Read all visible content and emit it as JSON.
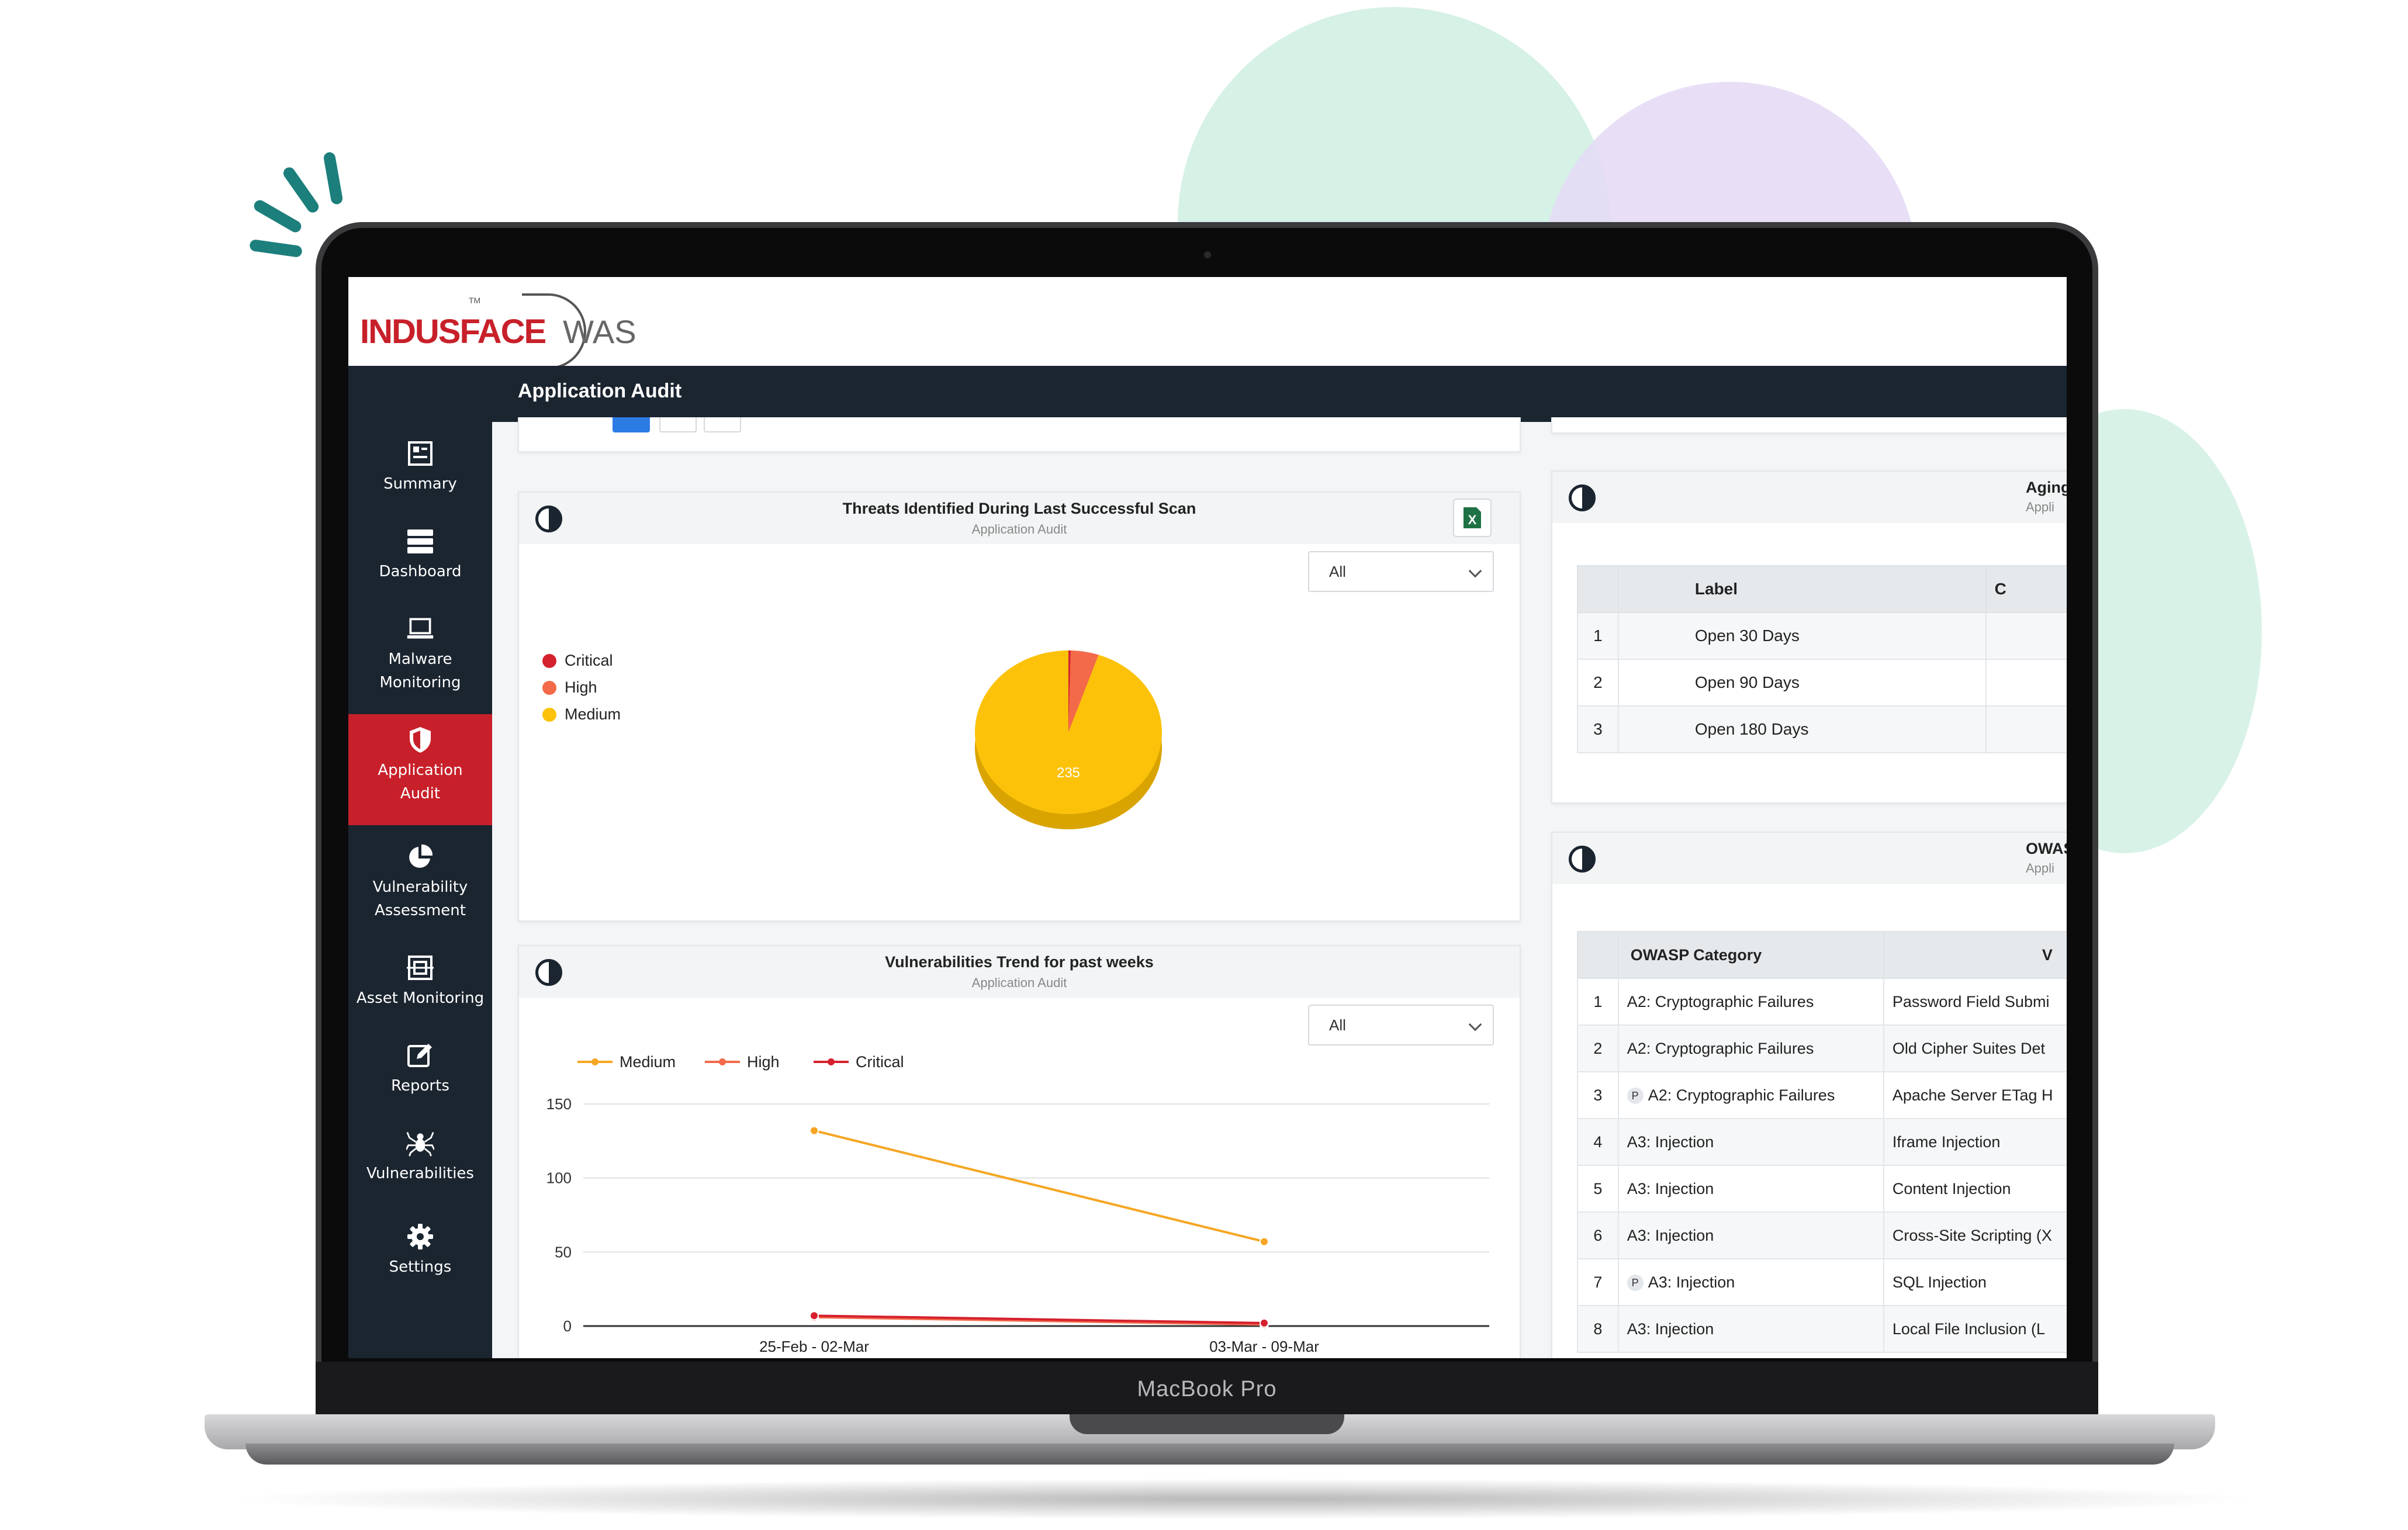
{
  "device": {
    "label": "MacBook Pro"
  },
  "app": {
    "logo_text": "INDUSFACE",
    "logo_sub": "WAS",
    "logo_tm": "TM",
    "page_title": "Application Audit"
  },
  "sidebar": {
    "items": [
      {
        "label": "Summary",
        "icon": "summary-icon"
      },
      {
        "label": "Dashboard",
        "icon": "dashboard-icon"
      },
      {
        "label": "Malware Monitoring",
        "icon": "laptop-icon"
      },
      {
        "label": "Application Audit",
        "icon": "shield-icon",
        "active": true
      },
      {
        "label": "Vulnerability Assessment",
        "icon": "pie-icon"
      },
      {
        "label": "Asset Monitoring",
        "icon": "asset-icon"
      },
      {
        "label": "Reports",
        "icon": "edit-icon"
      },
      {
        "label": "Vulnerabilities",
        "icon": "spider-icon"
      },
      {
        "label": "Settings",
        "icon": "gear-icon"
      }
    ]
  },
  "threats_card": {
    "title": "Threats Identified During Last Successful Scan",
    "subtitle": "Application Audit",
    "filter": "All",
    "legend": [
      {
        "label": "Critical",
        "color": "#d5202e"
      },
      {
        "label": "High",
        "color": "#f36a4a"
      },
      {
        "label": "Medium",
        "color": "#fcc20a"
      }
    ]
  },
  "trend_card": {
    "title": "Vulnerabilities Trend for past weeks",
    "subtitle": "Application Audit",
    "filter": "All"
  },
  "aging_card": {
    "title": "Aging",
    "subtitle": "Appli",
    "columns": [
      "",
      "Label",
      "C"
    ],
    "rows": [
      {
        "n": "1",
        "label": "Open 30 Days"
      },
      {
        "n": "2",
        "label": "Open 90 Days"
      },
      {
        "n": "3",
        "label": "Open 180 Days"
      }
    ]
  },
  "owasp_card": {
    "title": "OWAS",
    "subtitle": "Appli",
    "columns": [
      "",
      "OWASP Category",
      "V"
    ],
    "rows": [
      {
        "n": "1",
        "p": false,
        "category": "A2: Cryptographic Failures",
        "vuln": "Password Field Submi"
      },
      {
        "n": "2",
        "p": false,
        "category": "A2: Cryptographic Failures",
        "vuln": "Old Cipher Suites Det"
      },
      {
        "n": "3",
        "p": true,
        "category": "A2: Cryptographic Failures",
        "vuln": "Apache Server ETag H"
      },
      {
        "n": "4",
        "p": false,
        "category": "A3: Injection",
        "vuln": "Iframe Injection"
      },
      {
        "n": "5",
        "p": false,
        "category": "A3: Injection",
        "vuln": "Content Injection"
      },
      {
        "n": "6",
        "p": false,
        "category": "A3: Injection",
        "vuln": "Cross-Site Scripting (X"
      },
      {
        "n": "7",
        "p": true,
        "category": "A3: Injection",
        "vuln": "SQL Injection"
      },
      {
        "n": "8",
        "p": false,
        "category": "A3: Injection",
        "vuln": "Local File Inclusion (L"
      }
    ],
    "p_badge": "P"
  },
  "chart_data": [
    {
      "type": "pie",
      "title": "Threats Identified During Last Successful Scan",
      "subtitle": "Application Audit",
      "categories": [
        "Critical",
        "High",
        "Medium"
      ],
      "values": [
        1,
        12,
        235
      ],
      "colors": [
        "#d5202e",
        "#f36a4a",
        "#fcc20a"
      ],
      "data_labels": [
        "",
        "",
        "235"
      ],
      "legend_position": "left"
    },
    {
      "type": "line",
      "title": "Vulnerabilities Trend for past weeks",
      "subtitle": "Application Audit",
      "x": [
        "25-Feb - 02-Mar",
        "03-Mar - 09-Mar"
      ],
      "series": [
        {
          "name": "Medium",
          "values": [
            132,
            57
          ],
          "color": "#f6a623"
        },
        {
          "name": "High",
          "values": [
            6,
            1
          ],
          "color": "#f36a4a"
        },
        {
          "name": "Critical",
          "values": [
            7,
            2
          ],
          "color": "#d5202e"
        }
      ],
      "yticks": [
        "150",
        "100",
        "50",
        "0"
      ],
      "ylim": [
        0,
        150
      ],
      "grid": true,
      "legend_position": "top-left"
    }
  ]
}
